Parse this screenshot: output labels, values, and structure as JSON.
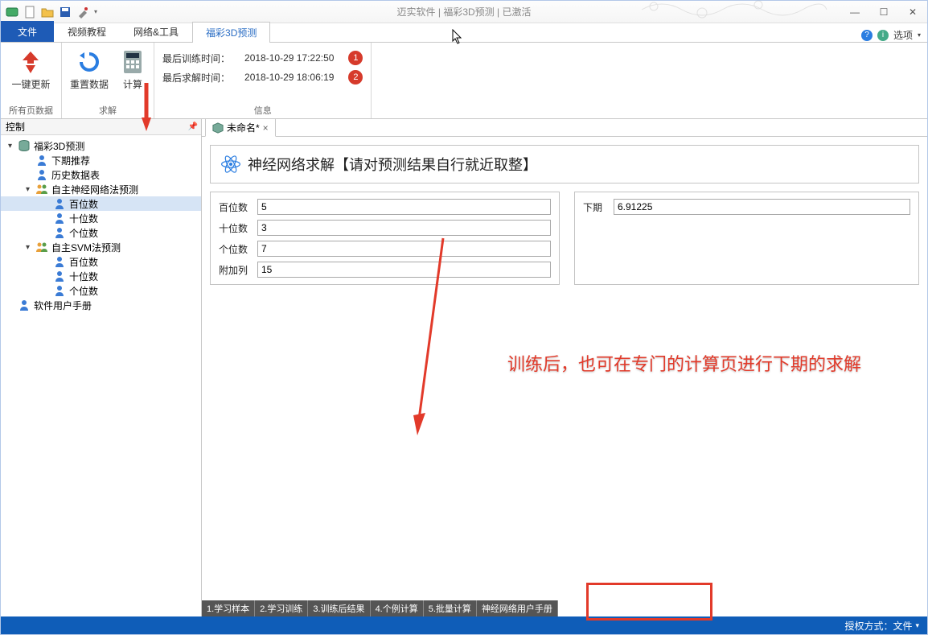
{
  "app_title": "迈实软件 | 福彩3D预测 | 已激活",
  "win": {
    "min": "—",
    "max": "☐",
    "close": "✕"
  },
  "menu": {
    "file": "文件",
    "tabs": [
      "视频教程",
      "网络&工具",
      "福彩3D预测"
    ],
    "active_index": 2,
    "options": "选项"
  },
  "ribbon": {
    "g1": {
      "label": "所有页数据",
      "item": "一键更新"
    },
    "g2": {
      "label": "求解",
      "items": [
        "重置数据",
        "计算"
      ]
    },
    "g3": {
      "label": "信息",
      "rows": [
        {
          "label": "最后训练时间：",
          "value": "2018-10-29 17:22:50",
          "badge": "1"
        },
        {
          "label": "最后求解时间：",
          "value": "2018-10-29 18:06:19",
          "badge": "2"
        }
      ]
    }
  },
  "side": {
    "title": "控制",
    "tree": [
      {
        "lvl": 0,
        "tw": "v",
        "ico": "db",
        "label": "福彩3D预测"
      },
      {
        "lvl": 1,
        "tw": "",
        "ico": "person",
        "label": "下期推荐"
      },
      {
        "lvl": 1,
        "tw": "",
        "ico": "person",
        "label": "历史数据表"
      },
      {
        "lvl": 1,
        "tw": "v",
        "ico": "group",
        "label": "自主神经网络法预测"
      },
      {
        "lvl": 2,
        "tw": "",
        "ico": "person",
        "label": "百位数",
        "sel": true
      },
      {
        "lvl": 2,
        "tw": "",
        "ico": "person",
        "label": "十位数"
      },
      {
        "lvl": 2,
        "tw": "",
        "ico": "person",
        "label": "个位数"
      },
      {
        "lvl": 1,
        "tw": "v",
        "ico": "group",
        "label": "自主SVM法预测"
      },
      {
        "lvl": 2,
        "tw": "",
        "ico": "person",
        "label": "百位数"
      },
      {
        "lvl": 2,
        "tw": "",
        "ico": "person",
        "label": "十位数"
      },
      {
        "lvl": 2,
        "tw": "",
        "ico": "person",
        "label": "个位数"
      },
      {
        "lvl": 0,
        "tw": "",
        "ico": "person",
        "label": "软件用户手册"
      }
    ]
  },
  "doc": {
    "tab_label": "未命名*",
    "panel_title": "神经网络求解【请对预测结果自行就近取整】",
    "left": [
      {
        "label": "百位数",
        "value": "5"
      },
      {
        "label": "十位数",
        "value": "3"
      },
      {
        "label": "个位数",
        "value": "7"
      },
      {
        "label": "附加列",
        "value": "15"
      }
    ],
    "right": {
      "label": "下期",
      "value": "6.91225"
    }
  },
  "bottom_tabs": [
    "1.学习样本",
    "2.学习训练",
    "3.训练后结果",
    "4.个例计算",
    "5.批量计算",
    "神经网络用户手册"
  ],
  "annotation": "训练后，也可在专门的计算页进行下期的求解",
  "status": "授权方式：文件",
  "colors": {
    "red": "#e23a2a",
    "blue": "#1e5bb6"
  }
}
